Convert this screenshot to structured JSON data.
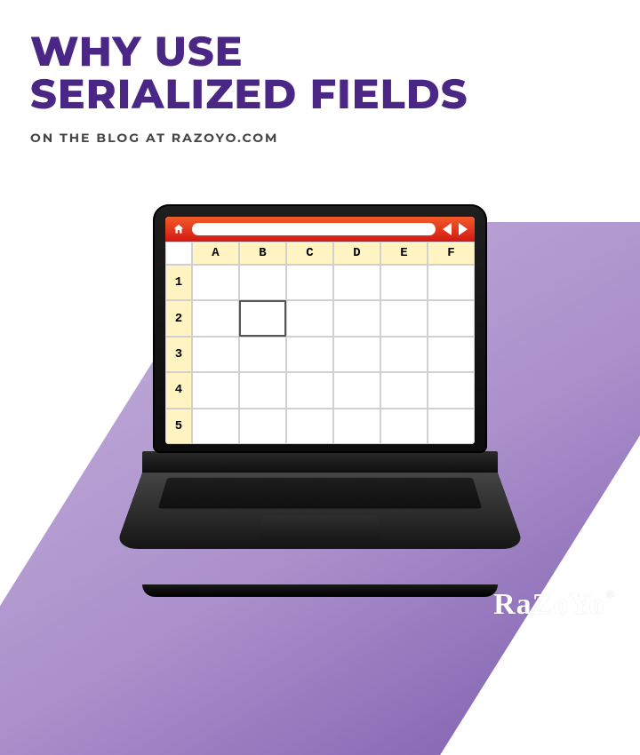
{
  "headline": {
    "line1": "WHY USE",
    "line2": "SERIALIZED FIELDS"
  },
  "subhead": "ON THE BLOG AT RAZOYO.COM",
  "spreadsheet": {
    "columns": [
      "A",
      "B",
      "C",
      "D",
      "E",
      "F"
    ],
    "rows": [
      "1",
      "2",
      "3",
      "4",
      "5"
    ],
    "selected_cell": "B2"
  },
  "brand": {
    "name": "RaZoYo",
    "registered": "®"
  },
  "colors": {
    "purple": "#4b2785",
    "barFrom": "#f25a28",
    "barTo": "#d21914",
    "header": "#fff4c2"
  }
}
